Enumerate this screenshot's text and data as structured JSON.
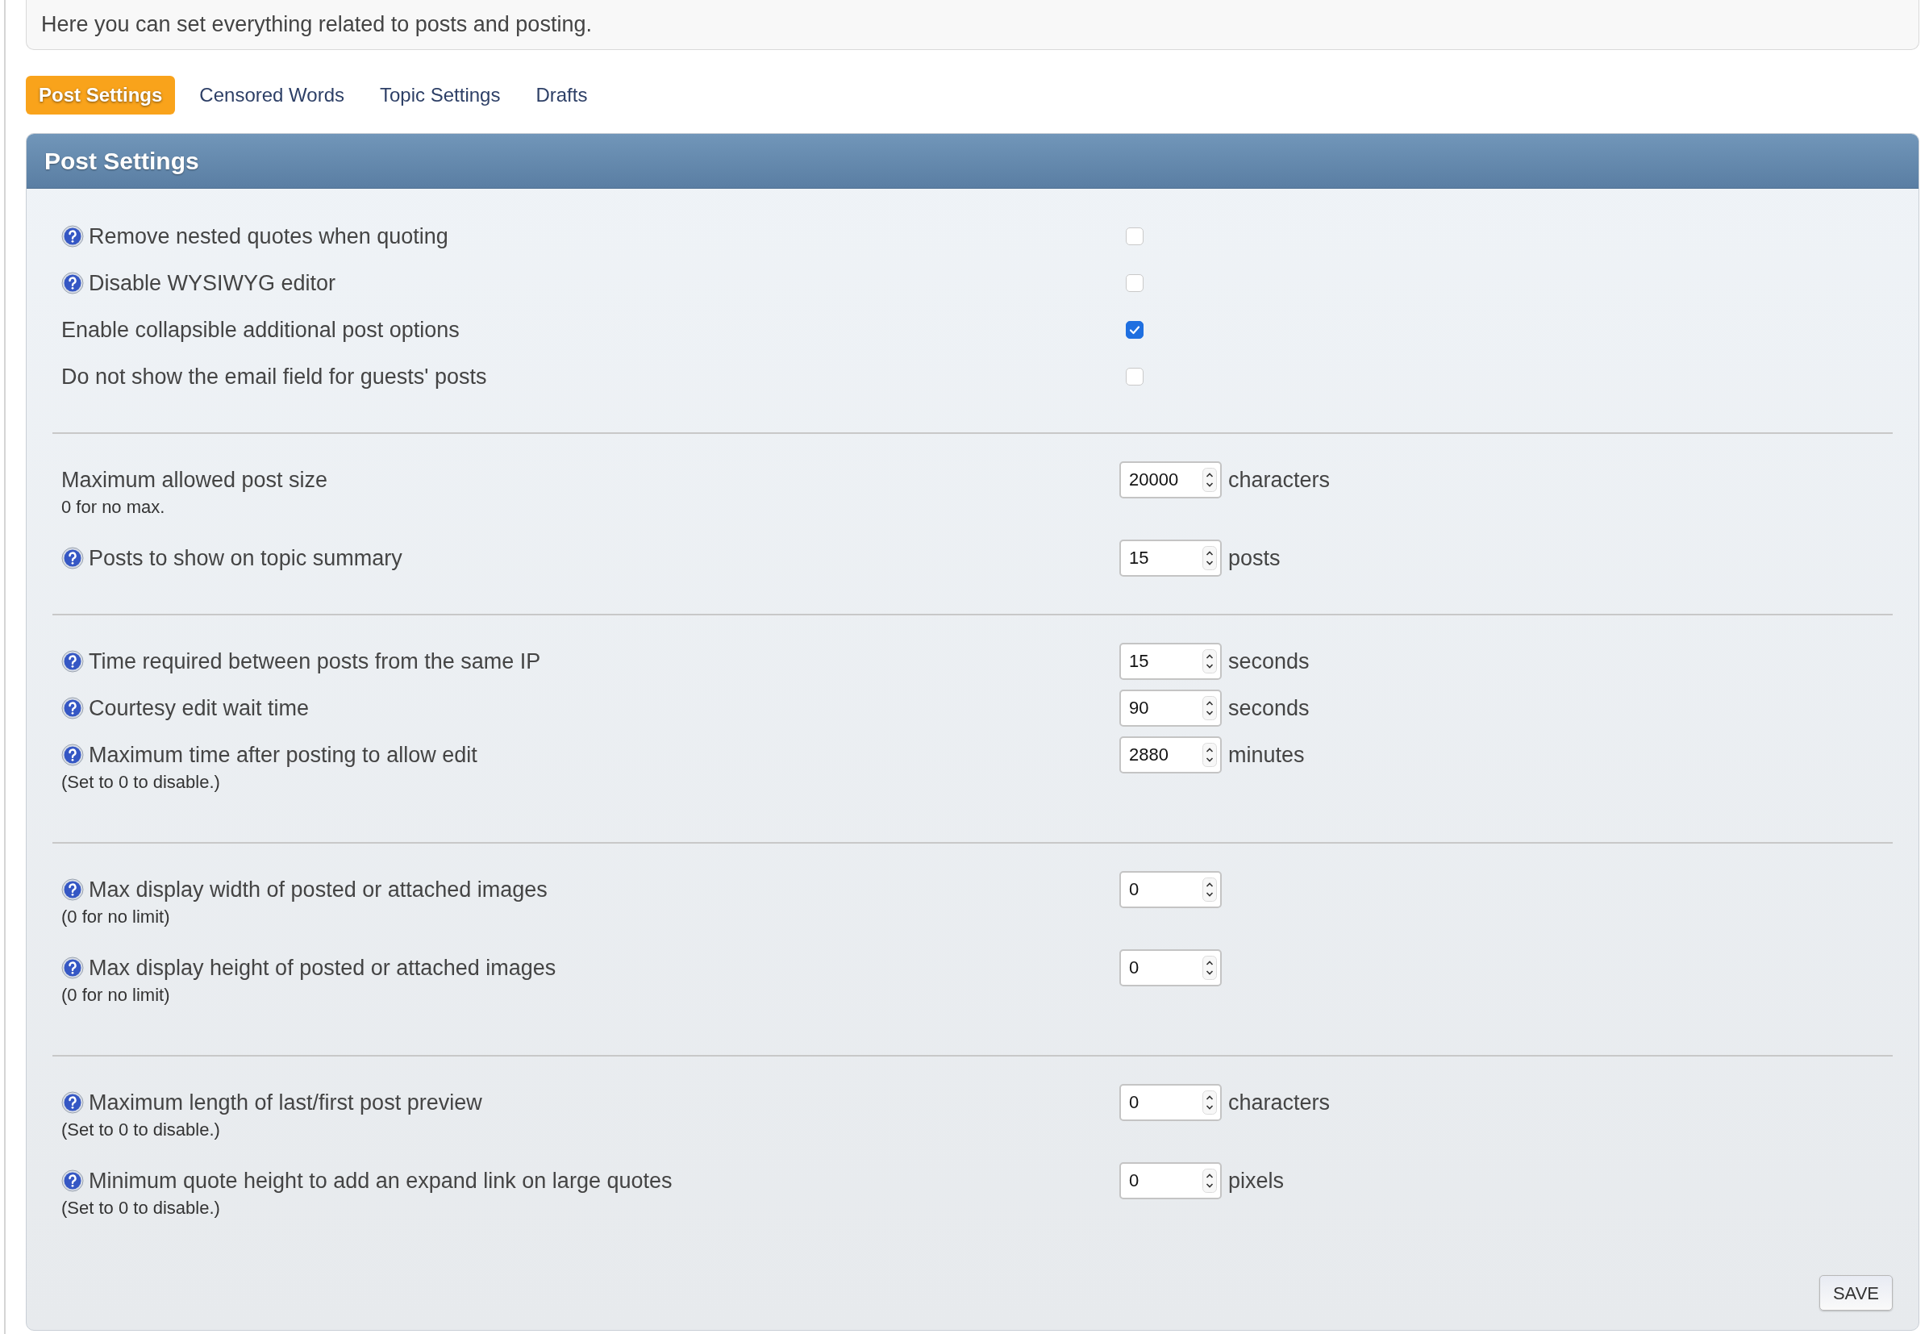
{
  "intro": {
    "text": "Here you can set everything related to posts and posting."
  },
  "tabs": [
    {
      "label": "Post Settings",
      "selected": true
    },
    {
      "label": "Censored Words",
      "selected": false
    },
    {
      "label": "Topic Settings",
      "selected": false
    },
    {
      "label": "Drafts",
      "selected": false
    }
  ],
  "panel": {
    "title": "Post Settings",
    "sections": [
      {
        "rows": [
          {
            "kind": "checkbox",
            "help": true,
            "label": "Remove nested quotes when quoting",
            "checked": false
          },
          {
            "kind": "checkbox",
            "help": true,
            "label": "Disable WYSIWYG editor",
            "checked": false
          },
          {
            "kind": "checkbox",
            "help": false,
            "label": "Enable collapsible additional post options",
            "checked": true
          },
          {
            "kind": "checkbox",
            "help": false,
            "label": "Do not show the email field for guests' posts",
            "checked": false
          }
        ]
      },
      {
        "rows": [
          {
            "kind": "number",
            "help": false,
            "label": "Maximum allowed post size",
            "note": "0 for no max.",
            "value": "20000",
            "unit": "characters"
          },
          {
            "kind": "number",
            "help": true,
            "label": "Posts to show on topic summary",
            "value": "15",
            "unit": "posts"
          }
        ]
      },
      {
        "rows": [
          {
            "kind": "number",
            "help": true,
            "label": "Time required between posts from the same IP",
            "value": "15",
            "unit": "seconds"
          },
          {
            "kind": "number",
            "help": true,
            "label": "Courtesy edit wait time",
            "value": "90",
            "unit": "seconds"
          },
          {
            "kind": "number",
            "help": true,
            "label": "Maximum time after posting to allow edit",
            "note": "(Set to 0 to disable.)",
            "value": "2880",
            "unit": "minutes"
          }
        ]
      },
      {
        "rows": [
          {
            "kind": "number",
            "help": true,
            "label": "Max display width of posted or attached images",
            "note": "(0 for no limit)",
            "value": "0"
          },
          {
            "kind": "number",
            "help": true,
            "label": "Max display height of posted or attached images",
            "note": "(0 for no limit)",
            "value": "0"
          }
        ]
      },
      {
        "rows": [
          {
            "kind": "number",
            "help": true,
            "label": "Maximum length of last/first post preview",
            "note": "(Set to 0 to disable.)",
            "value": "0",
            "unit": "characters"
          },
          {
            "kind": "number",
            "help": true,
            "label": "Minimum quote height to add an expand link on large quotes",
            "note": "(Set to 0 to disable.)",
            "value": "0",
            "unit": "pixels"
          }
        ]
      }
    ],
    "save_button": "SAVE"
  }
}
